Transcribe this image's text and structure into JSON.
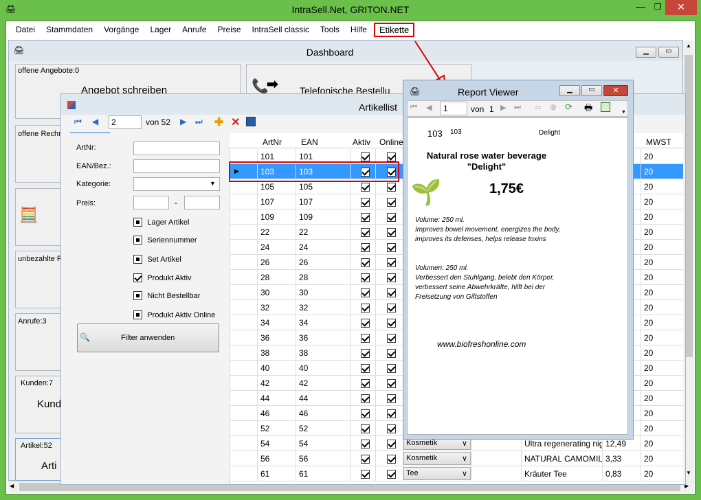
{
  "app": {
    "title": "IntraSell.Net, GRITON.NET"
  },
  "menu": [
    "Datei",
    "Stammdaten",
    "Vorgänge",
    "Lager",
    "Anrufe",
    "Preise",
    "IntraSell classic",
    "Tools",
    "Hilfe",
    "Etikette"
  ],
  "dashboard": {
    "title": "Dashboard",
    "tiles": {
      "offene_angebote": "offene Angebote:0",
      "angebot_schreiben": "Angebot schreiben",
      "telefonische": "Telefonische Bestellu",
      "offene_rechn": "offene Rechn",
      "unbezahlte": "unbezahlte R",
      "anrufe": "Anrufe:3",
      "kunden": "Kunden:7",
      "kund": "Kund",
      "artikel": "Artikel:52",
      "arti": "Arti"
    }
  },
  "artikelliste": {
    "title": "Artikellist",
    "nav": {
      "position": "2",
      "of": "von 52"
    },
    "filter": {
      "artnr_label": "ArtNr:",
      "ean_label": "EAN/Bez.:",
      "kategorie_label": "Kategorie:",
      "preis_label": "Preis:",
      "preis_sep": "-",
      "checks": [
        {
          "label": "Lager Artikel",
          "state": "indeterminate"
        },
        {
          "label": "Seriennummer",
          "state": "indeterminate"
        },
        {
          "label": "Set Artikel",
          "state": "indeterminate"
        },
        {
          "label": "Produkt Aktiv",
          "state": "checked"
        },
        {
          "label": "Nicht Bestellbar",
          "state": "indeterminate"
        },
        {
          "label": "Produkt Aktiv Online",
          "state": "indeterminate"
        }
      ],
      "apply_button": "Filter anwenden"
    },
    "columns": [
      "ArtNr",
      "EAN",
      "Aktiv",
      "Online",
      "MWST"
    ],
    "rows": [
      {
        "artnr": "101",
        "ean": "101",
        "kat": "",
        "bez": "",
        "preis": "",
        "mwst": "20"
      },
      {
        "artnr": "103",
        "ean": "103",
        "kat": "",
        "bez": "",
        "preis": "",
        "mwst": "20",
        "selected": true
      },
      {
        "artnr": "105",
        "ean": "105",
        "kat": "",
        "bez": "",
        "preis": "",
        "mwst": "20"
      },
      {
        "artnr": "107",
        "ean": "107",
        "kat": "",
        "bez": "",
        "preis": "",
        "mwst": "20"
      },
      {
        "artnr": "109",
        "ean": "109",
        "kat": "",
        "bez": "",
        "preis": "",
        "mwst": "20"
      },
      {
        "artnr": "22",
        "ean": "22",
        "kat": "",
        "bez": "",
        "preis": "",
        "mwst": "20"
      },
      {
        "artnr": "24",
        "ean": "24",
        "kat": "",
        "bez": "",
        "preis": "",
        "mwst": "20"
      },
      {
        "artnr": "26",
        "ean": "26",
        "kat": "",
        "bez": "",
        "preis": "",
        "mwst": "20"
      },
      {
        "artnr": "28",
        "ean": "28",
        "kat": "",
        "bez": "",
        "preis": "",
        "mwst": "20"
      },
      {
        "artnr": "30",
        "ean": "30",
        "kat": "",
        "bez": "",
        "preis": "",
        "mwst": "20"
      },
      {
        "artnr": "32",
        "ean": "32",
        "kat": "",
        "bez": "",
        "preis": "",
        "mwst": "20"
      },
      {
        "artnr": "34",
        "ean": "34",
        "kat": "",
        "bez": "",
        "preis": "",
        "mwst": "20"
      },
      {
        "artnr": "36",
        "ean": "36",
        "kat": "",
        "bez": "",
        "preis": "",
        "mwst": "20"
      },
      {
        "artnr": "38",
        "ean": "38",
        "kat": "",
        "bez": "",
        "preis": "",
        "mwst": "20"
      },
      {
        "artnr": "40",
        "ean": "40",
        "kat": "",
        "bez": "",
        "preis": "",
        "mwst": "20"
      },
      {
        "artnr": "42",
        "ean": "42",
        "kat": "",
        "bez": "",
        "preis": "",
        "mwst": "20"
      },
      {
        "artnr": "44",
        "ean": "44",
        "kat": "",
        "bez": "",
        "preis": "",
        "mwst": "20"
      },
      {
        "artnr": "46",
        "ean": "46",
        "kat": "",
        "bez": "",
        "preis": "",
        "mwst": "20"
      },
      {
        "artnr": "52",
        "ean": "52",
        "kat": "",
        "bez": "",
        "preis": "",
        "mwst": "20"
      },
      {
        "artnr": "54",
        "ean": "54",
        "kat": "Kosmetik",
        "bez": "Ultra regenerating nig...",
        "preis": "12,49",
        "mwst": "20"
      },
      {
        "artnr": "56",
        "ean": "56",
        "kat": "Kosmetik",
        "bez": "NATURAL CAMOMIL...",
        "preis": "3,33",
        "mwst": "20"
      },
      {
        "artnr": "61",
        "ean": "61",
        "kat": "Tee",
        "bez": "Kräuter Tee",
        "preis": "0,83",
        "mwst": "20"
      }
    ]
  },
  "report": {
    "title": "Report Viewer",
    "page": "1",
    "of": "von",
    "total": "1",
    "code_big": "103",
    "code_small": "103",
    "brand": "Delight",
    "product_name": "Natural rose water beverage \"Delight\"",
    "price": "1,75€",
    "desc_en": "Volume: 250 ml.\nImproves bowel movement, energizes the body, improves its defenses, helps release toxins",
    "desc_de": "Volumen: 250 ml.\nVerbessert den Stuhlgang, belebt den Körper, verbessert seine Abwehrkräfte, hilft bei der Freisetzung von Giftstoffen",
    "url": "www.biofreshonline.com"
  },
  "colors": {
    "frame": "#6ac04a",
    "selection": "#3399ff",
    "highlight": "#e00000"
  }
}
